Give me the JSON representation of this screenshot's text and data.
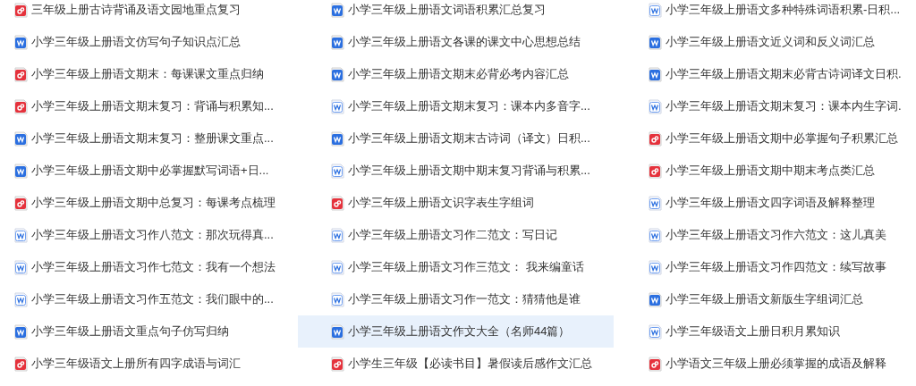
{
  "files": [
    {
      "title": "三年级上册古诗背诵及语文园地重点复习",
      "kind": "pdf",
      "selected": false
    },
    {
      "title": "小学三年级上册语文词语积累汇总复习",
      "kind": "word",
      "selected": false
    },
    {
      "title": "小学三年级上册语文多种特殊词语积累-日积...",
      "kind": "word_light",
      "selected": false
    },
    {
      "title": "小学三年级上册语文仿写句子知识点汇总",
      "kind": "word",
      "selected": false
    },
    {
      "title": "小学三年级上册语文各课的课文中心思想总结",
      "kind": "word",
      "selected": false
    },
    {
      "title": "小学三年级上册语文近义词和反义词汇总",
      "kind": "word",
      "selected": false
    },
    {
      "title": "小学三年级上册语文期末：每课课文重点归纳",
      "kind": "pdf",
      "selected": false
    },
    {
      "title": "小学三年级上册语文期末必背必考内容汇总",
      "kind": "word",
      "selected": false
    },
    {
      "title": "小学三年级上册语文期末必背古诗词译文日积.",
      "kind": "word",
      "selected": false
    },
    {
      "title": "小学三年级上册语文期末复习：背诵与积累知...",
      "kind": "pdf",
      "selected": false
    },
    {
      "title": "小学三年级上册语文期末复习：课本内多音字...",
      "kind": "word_light",
      "selected": false
    },
    {
      "title": "小学三年级上册语文期末复习：课本内生字词.",
      "kind": "word_light",
      "selected": false
    },
    {
      "title": "小学三年级上册语文期末复习：整册课文重点...",
      "kind": "word",
      "selected": false
    },
    {
      "title": "小学三年级上册语文期末古诗词（译文）日积...",
      "kind": "word",
      "selected": false
    },
    {
      "title": "小学三年级上册语文期中必掌握句子积累汇总",
      "kind": "pdf",
      "selected": false
    },
    {
      "title": "小学三年级上册语文期中必掌握默写词语+日...",
      "kind": "word",
      "selected": false
    },
    {
      "title": "小学三年级上册语文期中期末复习背诵与积累...",
      "kind": "word_light",
      "selected": false
    },
    {
      "title": "小学三年级上册语文期中期末考点类汇总",
      "kind": "pdf",
      "selected": false
    },
    {
      "title": "小学三年级上册语文期中总复习：每课考点梳理",
      "kind": "pdf",
      "selected": false
    },
    {
      "title": "小学三年级上册语文识字表生字组词",
      "kind": "pdf",
      "selected": false
    },
    {
      "title": "小学三年级上册语文四字词语及解释整理",
      "kind": "word_light",
      "selected": false
    },
    {
      "title": "小学三年级上册语文习作八范文：那次玩得真...",
      "kind": "word_light",
      "selected": false
    },
    {
      "title": "小学三年级上册语文习作二范文：写日记",
      "kind": "word_light",
      "selected": false
    },
    {
      "title": "小学三年级上册语文习作六范文：这儿真美",
      "kind": "word_light",
      "selected": false
    },
    {
      "title": "小学三年级上册语文习作七范文：我有一个想法",
      "kind": "word_light",
      "selected": false
    },
    {
      "title": "小学三年级上册语文习作三范文： 我来编童话",
      "kind": "word_light",
      "selected": false
    },
    {
      "title": "小学三年级上册语文习作四范文：续写故事",
      "kind": "word_light",
      "selected": false
    },
    {
      "title": "小学三年级上册语文习作五范文：我们眼中的...",
      "kind": "word_light",
      "selected": false
    },
    {
      "title": "小学三年级上册语文习作一范文：猜猜他是谁",
      "kind": "word_light",
      "selected": false
    },
    {
      "title": "小学三年级上册语文新版生字组词汇总",
      "kind": "word",
      "selected": false
    },
    {
      "title": "小学三年级上册语文重点句子仿写归纳",
      "kind": "word",
      "selected": false
    },
    {
      "title": "小学三年级上册语文作文大全（名师44篇）",
      "kind": "word",
      "selected": true
    },
    {
      "title": "小学三年级语文上册日积月累知识",
      "kind": "word_light",
      "selected": false
    },
    {
      "title": "小学三年级语文上册所有四字成语与词汇",
      "kind": "pdf",
      "selected": false
    },
    {
      "title": "小学生三年级【必读书目】暑假读后感作文汇总",
      "kind": "pdf",
      "selected": false
    },
    {
      "title": "小学语文三年级上册必须掌握的成语及解释",
      "kind": "pdf",
      "selected": false
    }
  ]
}
